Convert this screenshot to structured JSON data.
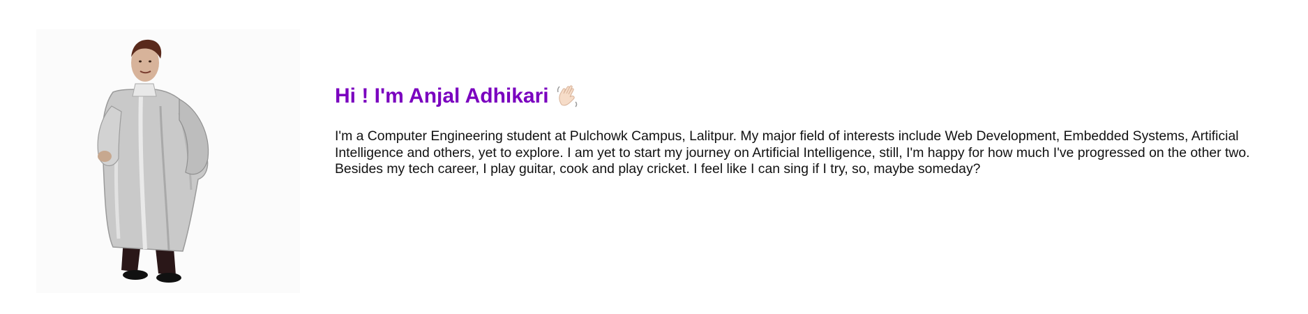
{
  "profile": {
    "photo_alt": "Profile picture",
    "heading": "Hi ! I'm Anjal Adhikari",
    "wave_icon": "waving-hand-icon",
    "bio": "I'm a Computer Engineering student at Pulchowk Campus, Lalitpur. My major field of interests include Web Development, Embedded Systems, Artificial Intelligence and others, yet to explore. I am yet to start my journey on Artificial Intelligence, still, I'm happy for how much I've progressed on the other two. Besides my tech career, I play guitar, cook and play cricket. I feel like I can sing if I try, so, maybe someday?"
  },
  "colors": {
    "heading": "#7a00bf",
    "text": "#111111",
    "background": "#ffffff"
  }
}
